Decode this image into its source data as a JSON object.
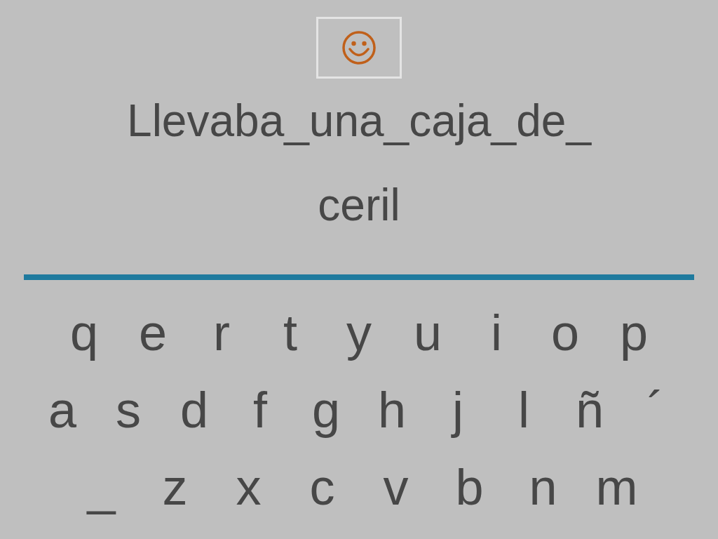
{
  "sentence": "Llevaba_una_caja_de_",
  "answer": "ceril",
  "keyboard": [
    [
      "q",
      "e",
      "r",
      "t",
      "y",
      "u",
      "i",
      "o",
      "p"
    ],
    [
      "a",
      "s",
      "d",
      "f",
      "g",
      "h",
      "j",
      "l",
      "ñ",
      "´"
    ],
    [
      "_",
      "z",
      "x",
      "c",
      "v",
      "b",
      "n",
      "m"
    ]
  ]
}
